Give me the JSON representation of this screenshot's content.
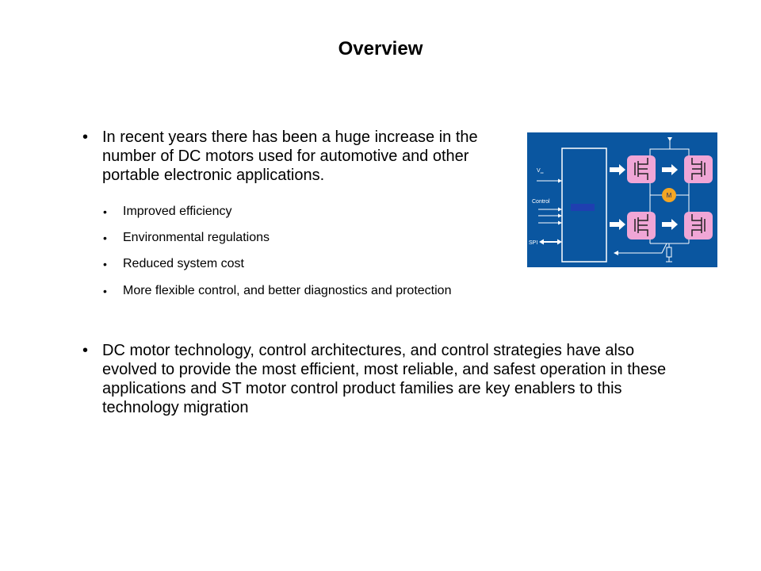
{
  "slide": {
    "title": "Overview",
    "bullets": [
      {
        "text": "In recent years there has been a huge increase in the number of DC motors used for automotive and other portable electronic applications.",
        "sub_bullets": [
          "Improved efficiency",
          "Environmental regulations",
          "Reduced system cost",
          "More flexible control, and better diagnostics and protection"
        ]
      },
      {
        "text": "DC motor technology, control architectures, and control strategies have also evolved to provide the most efficient, most reliable, and safest operation in these applications and ST motor control product families are key enablers to this technology migration"
      }
    ],
    "bullet_glyph": "•"
  },
  "diagram": {
    "labels": {
      "vcc_main": "V",
      "vcc_sub": "cc",
      "control": "Control",
      "spi": "SPI",
      "motor": "M"
    },
    "colors": {
      "background": "#0a56a0",
      "mosfet_box": "#f0a6d6",
      "motor": "#f5a623",
      "controller_bar": "#1f3fb0",
      "lines": "#ffffff"
    }
  }
}
